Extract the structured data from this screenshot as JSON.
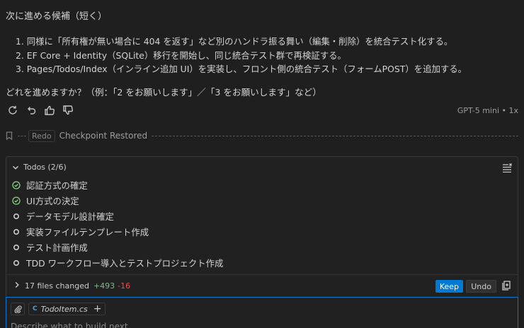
{
  "chat": {
    "heading": "次に進める候補（短く）",
    "steps": [
      "1. 同様に「所有権が無い場合に 404 を返す」など別のハンドラ振る舞い（編集・削除）を統合テスト化する。",
      "2. EF Core + Identity（SQLite）移行を開始し、同じ統合テスト群で再検証する。",
      "3. Pages/Todos/Index（インライン追加 UI）を実装し、フロント側の統合テスト（フォームPOST）を追加する。"
    ],
    "question": "どれを進めますか？（例：「2 をお願いします」／「3 をお願いします」など）",
    "model_info": "GPT-5 mini • 1x",
    "action_icons": [
      "retry-icon",
      "undo-icon",
      "thumbs-up-icon",
      "thumbs-down-icon"
    ]
  },
  "checkpoint": {
    "redo_label": "Redo",
    "label": "Checkpoint Restored"
  },
  "todos": {
    "header": "Todos (2/6)",
    "items": [
      {
        "label": "認証方式の確定",
        "done": true
      },
      {
        "label": "UI方式の決定",
        "done": true
      },
      {
        "label": "データモデル設計確定",
        "done": false
      },
      {
        "label": "実装ファイルテンプレート作成",
        "done": false
      },
      {
        "label": "テスト計画作成",
        "done": false
      },
      {
        "label": "TDD ワークフロー導入とテストプロジェクト作成",
        "done": false
      }
    ]
  },
  "files": {
    "label": "17 files changed",
    "added": "+493",
    "removed": "-16",
    "keep_label": "Keep",
    "undo_label": "Undo"
  },
  "input": {
    "chip_label": "TodoItem.cs",
    "chip_add": "+",
    "placeholder": "Describe what to build next"
  },
  "colors": {
    "accent": "#0078d4",
    "done_green": "#89d185",
    "added": "#81b88b",
    "removed": "#f14c4c",
    "background": "#1f1f1f"
  }
}
